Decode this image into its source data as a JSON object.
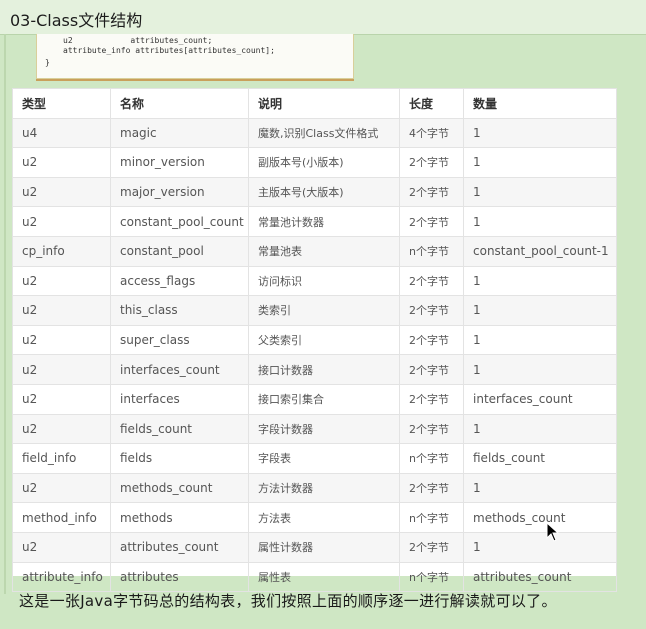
{
  "slide": {
    "title": "03-Class文件结构"
  },
  "code_snippet": {
    "lines": [
      "u2            attributes_count;",
      "attribute_info attributes[attributes_count];",
      "}"
    ]
  },
  "table": {
    "headers": [
      "类型",
      "名称",
      "说明",
      "长度",
      "数量"
    ],
    "rows": [
      [
        "u4",
        "magic",
        "魔数,识别Class文件格式",
        "4个字节",
        "1"
      ],
      [
        "u2",
        "minor_version",
        "副版本号(小版本)",
        "2个字节",
        "1"
      ],
      [
        "u2",
        "major_version",
        "主版本号(大版本)",
        "2个字节",
        "1"
      ],
      [
        "u2",
        "constant_pool_count",
        "常量池计数器",
        "2个字节",
        "1"
      ],
      [
        "cp_info",
        "constant_pool",
        "常量池表",
        "n个字节",
        "constant_pool_count-1"
      ],
      [
        "u2",
        "access_flags",
        "访问标识",
        "2个字节",
        "1"
      ],
      [
        "u2",
        "this_class",
        "类索引",
        "2个字节",
        "1"
      ],
      [
        "u2",
        "super_class",
        "父类索引",
        "2个字节",
        "1"
      ],
      [
        "u2",
        "interfaces_count",
        "接口计数器",
        "2个字节",
        "1"
      ],
      [
        "u2",
        "interfaces",
        "接口索引集合",
        "2个字节",
        "interfaces_count"
      ],
      [
        "u2",
        "fields_count",
        "字段计数器",
        "2个字节",
        "1"
      ],
      [
        "field_info",
        "fields",
        "字段表",
        "n个字节",
        "fields_count"
      ],
      [
        "u2",
        "methods_count",
        "方法计数器",
        "2个字节",
        "1"
      ],
      [
        "method_info",
        "methods",
        "方法表",
        "n个字节",
        "methods_count"
      ],
      [
        "u2",
        "attributes_count",
        "属性计数器",
        "2个字节",
        "1"
      ],
      [
        "attribute_info",
        "attributes",
        "属性表",
        "n个字节",
        "attributes_count"
      ]
    ]
  },
  "footer": {
    "text": "这是一张Java字节码总的结构表，我们按照上面的顺序逐一进行解读就可以了。"
  },
  "colors": {
    "background": "#cfe7c4",
    "title_bar": "#e4f1dd",
    "table_bg": "#ffffff",
    "row_alt": "#f6f6f6"
  },
  "icons": [
    "mouse-cursor-icon"
  ]
}
